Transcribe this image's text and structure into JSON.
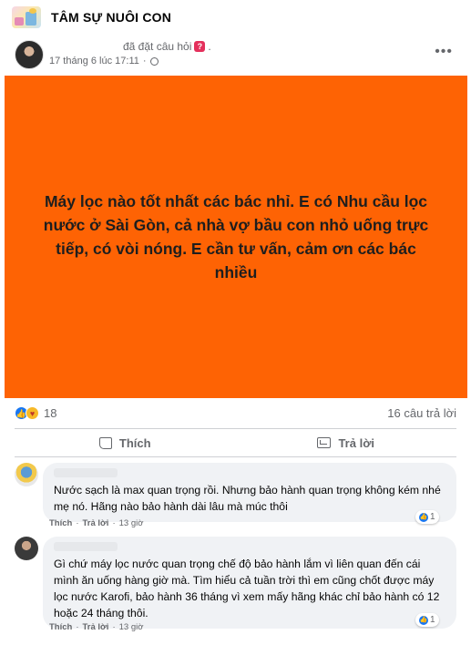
{
  "group": {
    "name": "TÂM SỰ NUÔI CON"
  },
  "post": {
    "action_text": "đã đặt câu hỏi",
    "trailing_dot": ".",
    "timestamp": "17 tháng 6 lúc 17:11",
    "dot_sep": "·",
    "more_icon": "more-horizontal-icon",
    "body": "Máy lọc nào tốt nhất các bác nhỉ. E có Nhu cầu lọc nước ở Sài Gòn, cả nhà vợ bầu con nhỏ uống trực tiếp, có vòi nóng. E cần tư vấn, cảm ơn các bác nhiều",
    "background_color": "#fe6304"
  },
  "stats": {
    "reactions": "18",
    "answers": "16 câu trả lời"
  },
  "actions": {
    "like_label": "Thích",
    "reply_label": "Trả lời"
  },
  "comments": [
    {
      "text": "Nước sạch là max quan trọng rồi. Nhưng bảo hành quan trọng không kém nhé mẹ nó. Hãng nào bảo hành dài lâu mà múc thôi",
      "reactions": "1",
      "like": "Thích",
      "reply": "Trả lời",
      "time": "13 giờ"
    },
    {
      "text": "Gì chứ máy lọc nước quan trọng chế độ bảo hành lắm vì liên quan đến cái mình ăn uống hàng giờ mà. Tìm hiểu cả tuần trời thì em cũng chốt được máy lọc nước Karofi, bảo hành 36 tháng vì xem mấy hãng khác chỉ bảo hành có 12 hoặc 24 tháng thôi.",
      "reactions": "1",
      "like": "Thích",
      "reply": "Trả lời",
      "time": "13 giờ"
    }
  ],
  "colors": {
    "accent": "#1877f2",
    "muted": "#65676b",
    "bubble": "#f0f2f5"
  }
}
